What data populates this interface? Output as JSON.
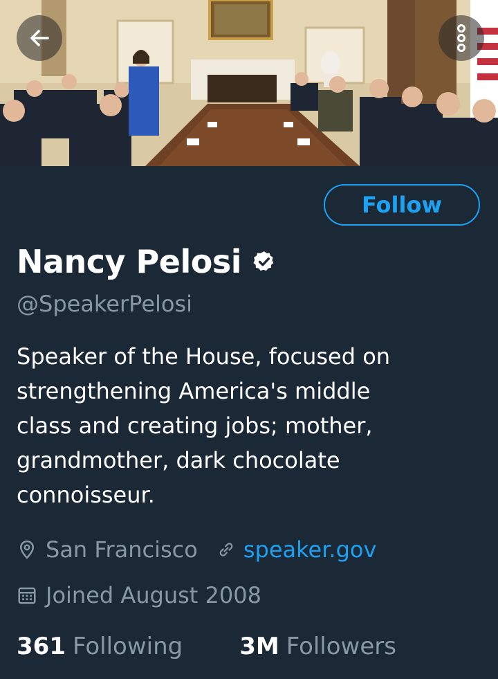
{
  "header": {
    "banner_description_icon": "photo",
    "back_icon": "arrow-left-icon",
    "more_icon": "more-vertical-icon"
  },
  "profile": {
    "follow_label": "Follow",
    "name": "Nancy Pelosi",
    "verified": true,
    "handle": "@SpeakerPelosi",
    "bio": "Speaker of the House, focused on\nstrengthening America's middle\nclass and creating jobs; mother,\ngrandmother, dark chocolate\nconnoisseur.",
    "location": "San Francisco",
    "website": "speaker.gov",
    "joined": "Joined August 2008",
    "stats": {
      "following_count": "361",
      "following_label": "Following",
      "followers_count": "3M",
      "followers_label": "Followers"
    }
  },
  "colors": {
    "background": "#1b2836",
    "accent": "#1da1f2",
    "secondary_text": "#8899a6",
    "primary_text": "#ffffff"
  }
}
